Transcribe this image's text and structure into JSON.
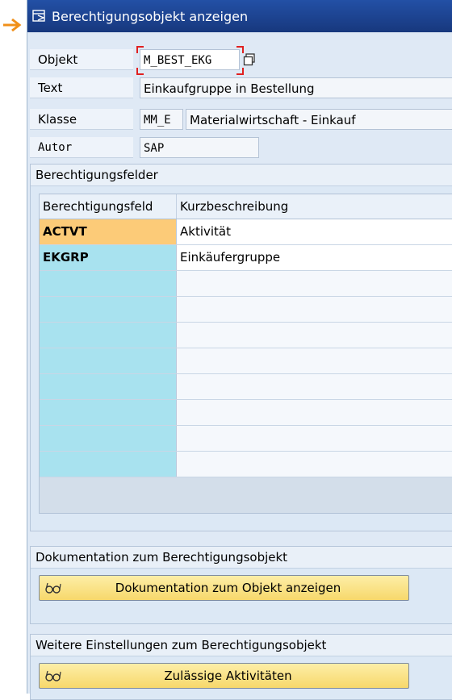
{
  "window": {
    "title": "Berechtigungsobjekt anzeigen",
    "icon": "display-icon"
  },
  "header_fields": {
    "objekt": {
      "label": "Objekt",
      "value": "M_BEST_EKG",
      "action_icon": "copy-icon"
    },
    "text": {
      "label": "Text",
      "value": "Einkaufgruppe in Bestellung"
    },
    "klasse": {
      "label": "Klasse",
      "code": "MM_E",
      "value": "Materialwirtschaft - Einkauf"
    },
    "autor": {
      "label": "Autor",
      "value": "SAP"
    }
  },
  "fields_group": {
    "title": "Berechtigungsfelder",
    "columns": [
      "Berechtigungsfeld",
      "Kurzbeschreibung"
    ],
    "rows": [
      {
        "field": "ACTVT",
        "desc": "Aktivität",
        "selected": true
      },
      {
        "field": "EKGRP",
        "desc": "Einkäufergruppe",
        "selected": false
      }
    ]
  },
  "doc_group": {
    "title": "Dokumentation zum Berechtigungsobjekt",
    "button_label": "Dokumentation zum Objekt anzeigen",
    "button_icon": "glasses-icon"
  },
  "settings_group": {
    "title": "Weitere Einstellungen zum Berechtigungsobjekt",
    "button_label": "Zulässige Aktivitäten",
    "button_icon": "glasses-icon"
  },
  "colors": {
    "title_bar": "#17387d",
    "selected_cell": "#fccb78",
    "key_column": "#a8e2ef",
    "button": "#f7d86b",
    "pointer_arrow": "#f0901a"
  }
}
